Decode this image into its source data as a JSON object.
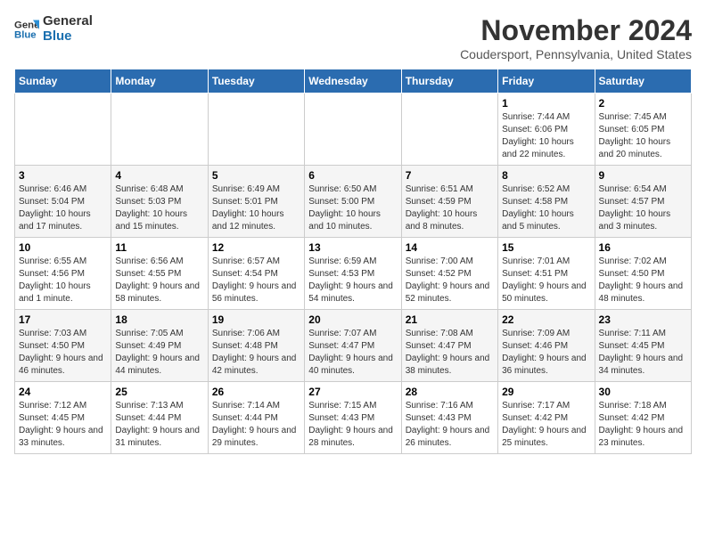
{
  "header": {
    "logo_line1": "General",
    "logo_line2": "Blue",
    "month_title": "November 2024",
    "location": "Coudersport, Pennsylvania, United States"
  },
  "days_of_week": [
    "Sunday",
    "Monday",
    "Tuesday",
    "Wednesday",
    "Thursday",
    "Friday",
    "Saturday"
  ],
  "weeks": [
    [
      {
        "day": "",
        "info": ""
      },
      {
        "day": "",
        "info": ""
      },
      {
        "day": "",
        "info": ""
      },
      {
        "day": "",
        "info": ""
      },
      {
        "day": "",
        "info": ""
      },
      {
        "day": "1",
        "info": "Sunrise: 7:44 AM\nSunset: 6:06 PM\nDaylight: 10 hours and 22 minutes."
      },
      {
        "day": "2",
        "info": "Sunrise: 7:45 AM\nSunset: 6:05 PM\nDaylight: 10 hours and 20 minutes."
      }
    ],
    [
      {
        "day": "3",
        "info": "Sunrise: 6:46 AM\nSunset: 5:04 PM\nDaylight: 10 hours and 17 minutes."
      },
      {
        "day": "4",
        "info": "Sunrise: 6:48 AM\nSunset: 5:03 PM\nDaylight: 10 hours and 15 minutes."
      },
      {
        "day": "5",
        "info": "Sunrise: 6:49 AM\nSunset: 5:01 PM\nDaylight: 10 hours and 12 minutes."
      },
      {
        "day": "6",
        "info": "Sunrise: 6:50 AM\nSunset: 5:00 PM\nDaylight: 10 hours and 10 minutes."
      },
      {
        "day": "7",
        "info": "Sunrise: 6:51 AM\nSunset: 4:59 PM\nDaylight: 10 hours and 8 minutes."
      },
      {
        "day": "8",
        "info": "Sunrise: 6:52 AM\nSunset: 4:58 PM\nDaylight: 10 hours and 5 minutes."
      },
      {
        "day": "9",
        "info": "Sunrise: 6:54 AM\nSunset: 4:57 PM\nDaylight: 10 hours and 3 minutes."
      }
    ],
    [
      {
        "day": "10",
        "info": "Sunrise: 6:55 AM\nSunset: 4:56 PM\nDaylight: 10 hours and 1 minute."
      },
      {
        "day": "11",
        "info": "Sunrise: 6:56 AM\nSunset: 4:55 PM\nDaylight: 9 hours and 58 minutes."
      },
      {
        "day": "12",
        "info": "Sunrise: 6:57 AM\nSunset: 4:54 PM\nDaylight: 9 hours and 56 minutes."
      },
      {
        "day": "13",
        "info": "Sunrise: 6:59 AM\nSunset: 4:53 PM\nDaylight: 9 hours and 54 minutes."
      },
      {
        "day": "14",
        "info": "Sunrise: 7:00 AM\nSunset: 4:52 PM\nDaylight: 9 hours and 52 minutes."
      },
      {
        "day": "15",
        "info": "Sunrise: 7:01 AM\nSunset: 4:51 PM\nDaylight: 9 hours and 50 minutes."
      },
      {
        "day": "16",
        "info": "Sunrise: 7:02 AM\nSunset: 4:50 PM\nDaylight: 9 hours and 48 minutes."
      }
    ],
    [
      {
        "day": "17",
        "info": "Sunrise: 7:03 AM\nSunset: 4:50 PM\nDaylight: 9 hours and 46 minutes."
      },
      {
        "day": "18",
        "info": "Sunrise: 7:05 AM\nSunset: 4:49 PM\nDaylight: 9 hours and 44 minutes."
      },
      {
        "day": "19",
        "info": "Sunrise: 7:06 AM\nSunset: 4:48 PM\nDaylight: 9 hours and 42 minutes."
      },
      {
        "day": "20",
        "info": "Sunrise: 7:07 AM\nSunset: 4:47 PM\nDaylight: 9 hours and 40 minutes."
      },
      {
        "day": "21",
        "info": "Sunrise: 7:08 AM\nSunset: 4:47 PM\nDaylight: 9 hours and 38 minutes."
      },
      {
        "day": "22",
        "info": "Sunrise: 7:09 AM\nSunset: 4:46 PM\nDaylight: 9 hours and 36 minutes."
      },
      {
        "day": "23",
        "info": "Sunrise: 7:11 AM\nSunset: 4:45 PM\nDaylight: 9 hours and 34 minutes."
      }
    ],
    [
      {
        "day": "24",
        "info": "Sunrise: 7:12 AM\nSunset: 4:45 PM\nDaylight: 9 hours and 33 minutes."
      },
      {
        "day": "25",
        "info": "Sunrise: 7:13 AM\nSunset: 4:44 PM\nDaylight: 9 hours and 31 minutes."
      },
      {
        "day": "26",
        "info": "Sunrise: 7:14 AM\nSunset: 4:44 PM\nDaylight: 9 hours and 29 minutes."
      },
      {
        "day": "27",
        "info": "Sunrise: 7:15 AM\nSunset: 4:43 PM\nDaylight: 9 hours and 28 minutes."
      },
      {
        "day": "28",
        "info": "Sunrise: 7:16 AM\nSunset: 4:43 PM\nDaylight: 9 hours and 26 minutes."
      },
      {
        "day": "29",
        "info": "Sunrise: 7:17 AM\nSunset: 4:42 PM\nDaylight: 9 hours and 25 minutes."
      },
      {
        "day": "30",
        "info": "Sunrise: 7:18 AM\nSunset: 4:42 PM\nDaylight: 9 hours and 23 minutes."
      }
    ]
  ]
}
